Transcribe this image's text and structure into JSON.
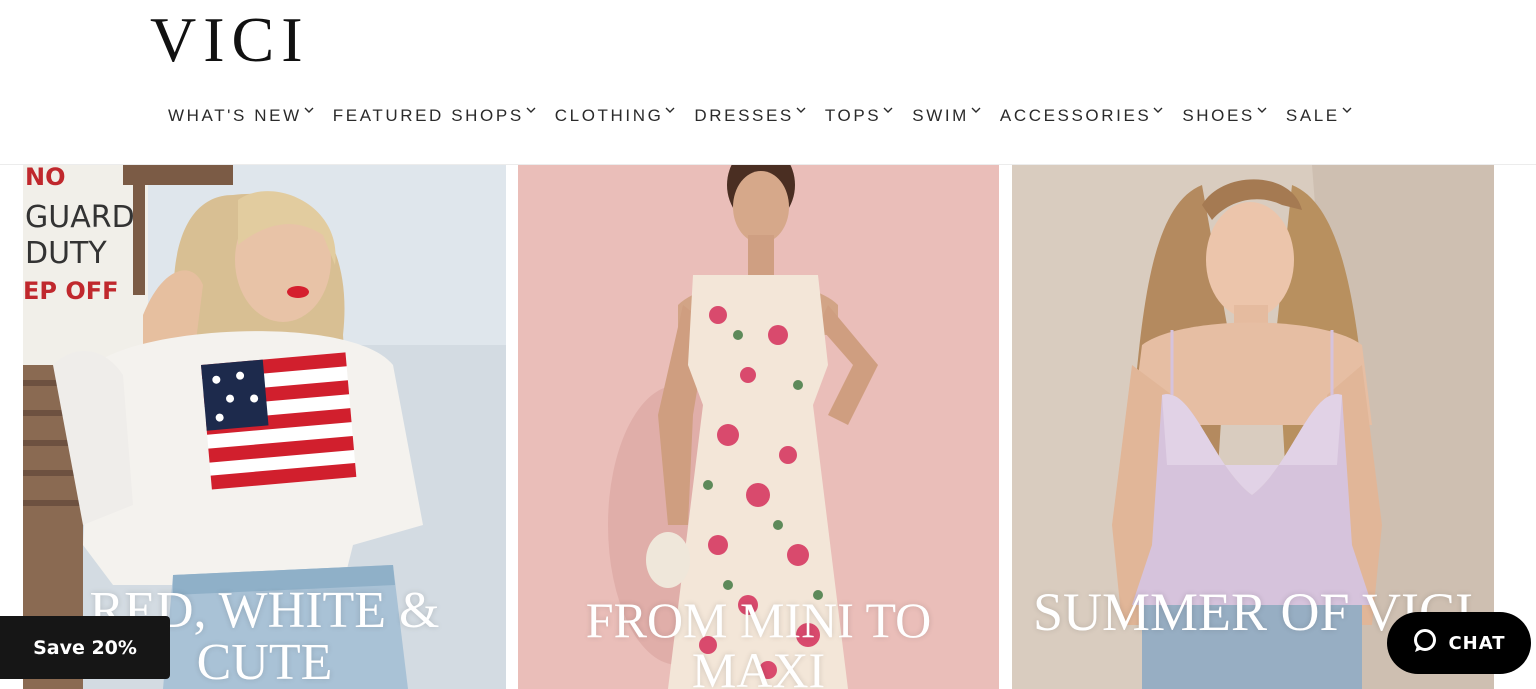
{
  "brand": {
    "logo_text": "VICI"
  },
  "nav": {
    "items": [
      {
        "label": "WHAT'S NEW"
      },
      {
        "label": "FEATURED SHOPS"
      },
      {
        "label": "CLOTHING"
      },
      {
        "label": "DRESSES"
      },
      {
        "label": "TOPS"
      },
      {
        "label": "SWIM"
      },
      {
        "label": "ACCESSORIES"
      },
      {
        "label": "SHOES"
      },
      {
        "label": "SALE"
      }
    ],
    "chevron_icon": "chevron-down-icon"
  },
  "tiles": [
    {
      "caption": "RED, WHITE & CUTE",
      "background_color": "#cfd6dc",
      "sign_text": [
        "NO",
        "GUARD",
        "DUTY",
        "EP OFF"
      ]
    },
    {
      "caption": "FROM MINI TO MAXI",
      "background_color": "#e9b9b5"
    },
    {
      "caption": "SUMMER OF VICI",
      "background_color": "#d8cbbd"
    }
  ],
  "promo": {
    "label": "Save 20%"
  },
  "chat": {
    "label": "CHAT",
    "icon": "chat-bubble-icon"
  },
  "colors": {
    "badge_bg": "#161616",
    "chat_bg": "#000000",
    "nav_text": "#2a2a2a"
  }
}
